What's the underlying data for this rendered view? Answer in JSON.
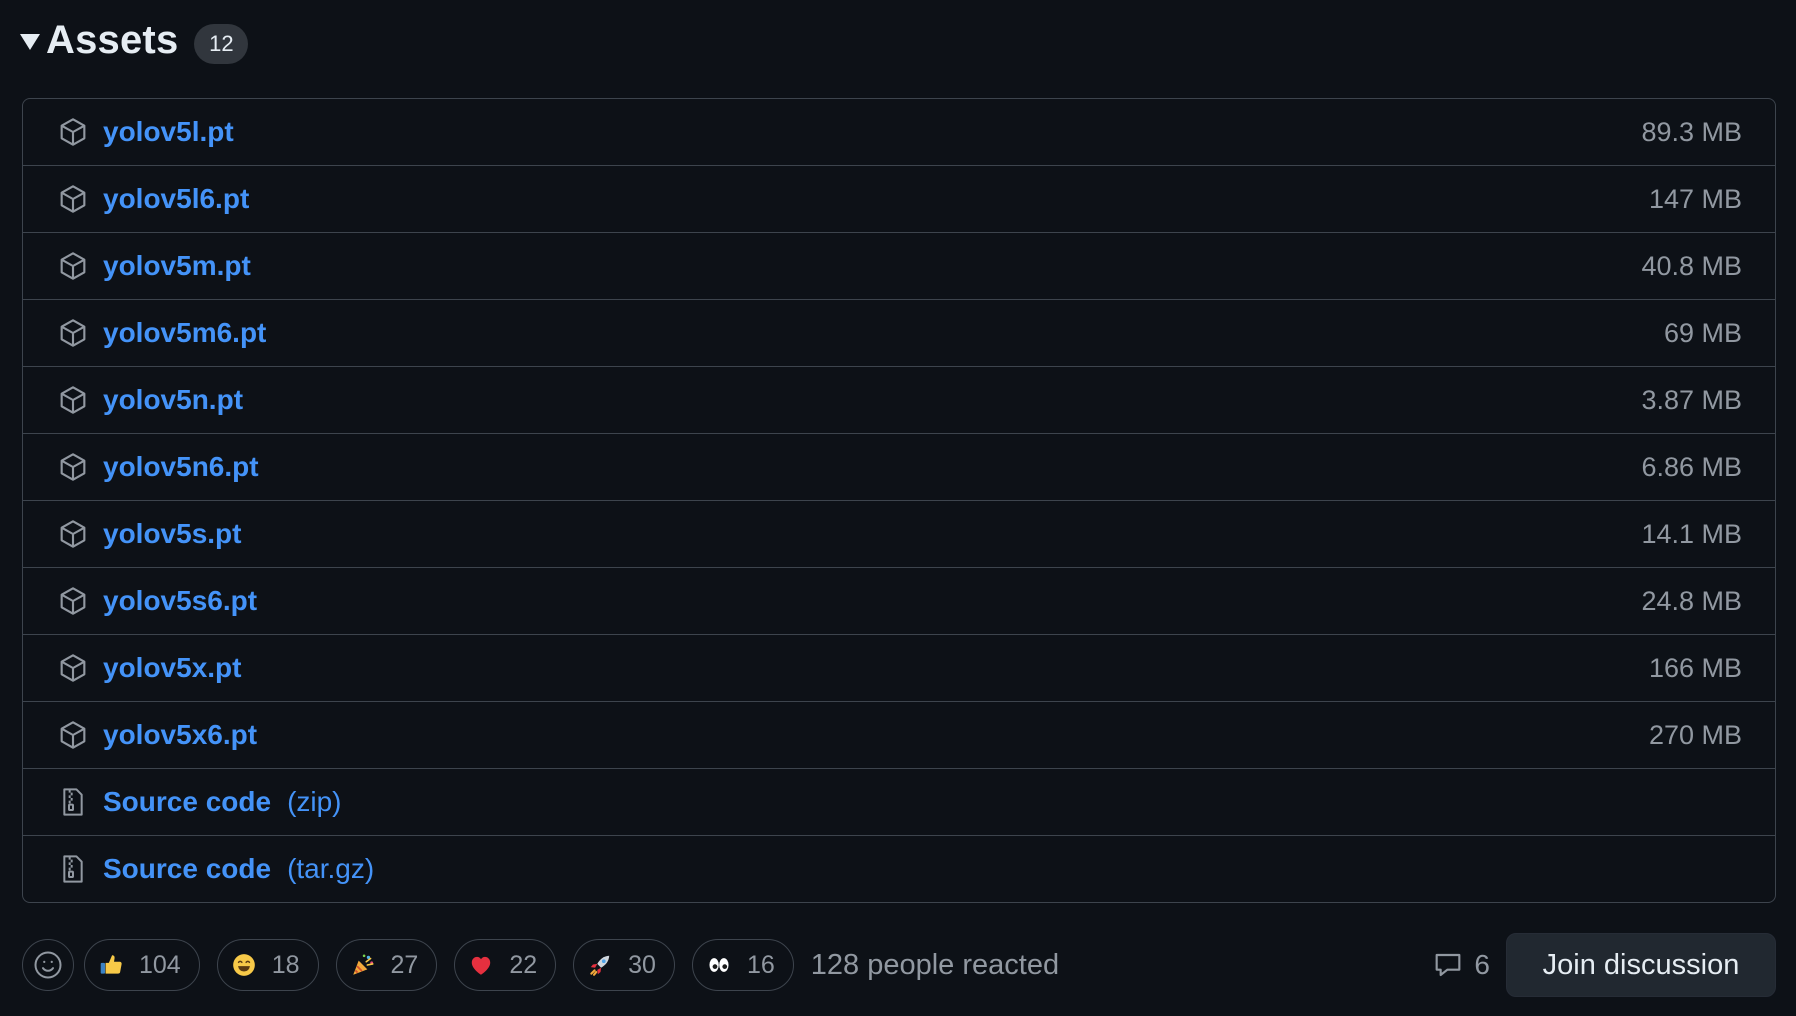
{
  "assets": {
    "title": "Assets",
    "count": "12",
    "items": [
      {
        "name": "yolov5l.pt",
        "size": "89.3 MB",
        "icon": "package-icon"
      },
      {
        "name": "yolov5l6.pt",
        "size": "147 MB",
        "icon": "package-icon"
      },
      {
        "name": "yolov5m.pt",
        "size": "40.8 MB",
        "icon": "package-icon"
      },
      {
        "name": "yolov5m6.pt",
        "size": "69 MB",
        "icon": "package-icon"
      },
      {
        "name": "yolov5n.pt",
        "size": "3.87 MB",
        "icon": "package-icon"
      },
      {
        "name": "yolov5n6.pt",
        "size": "6.86 MB",
        "icon": "package-icon"
      },
      {
        "name": "yolov5s.pt",
        "size": "14.1 MB",
        "icon": "package-icon"
      },
      {
        "name": "yolov5s6.pt",
        "size": "24.8 MB",
        "icon": "package-icon"
      },
      {
        "name": "yolov5x.pt",
        "size": "166 MB",
        "icon": "package-icon"
      },
      {
        "name": "yolov5x6.pt",
        "size": "270 MB",
        "icon": "package-icon"
      }
    ],
    "source": [
      {
        "name": "Source code",
        "suffix": "(zip)",
        "icon": "file-zip-icon"
      },
      {
        "name": "Source code",
        "suffix": "(tar.gz)",
        "icon": "file-zip-icon"
      }
    ]
  },
  "reactions": {
    "items": [
      {
        "emoji": "thumbs-up",
        "count": "104"
      },
      {
        "emoji": "laugh",
        "count": "18"
      },
      {
        "emoji": "hooray",
        "count": "27"
      },
      {
        "emoji": "heart",
        "count": "22"
      },
      {
        "emoji": "rocket",
        "count": "30"
      },
      {
        "emoji": "eyes",
        "count": "16"
      }
    ],
    "summary": "128 people reacted"
  },
  "discussion": {
    "comments_count": "6",
    "join_label": "Join discussion"
  },
  "colors": {
    "background": "#0d1117",
    "link": "#4493f8",
    "muted": "#9198a1",
    "border": "#3d444d"
  }
}
